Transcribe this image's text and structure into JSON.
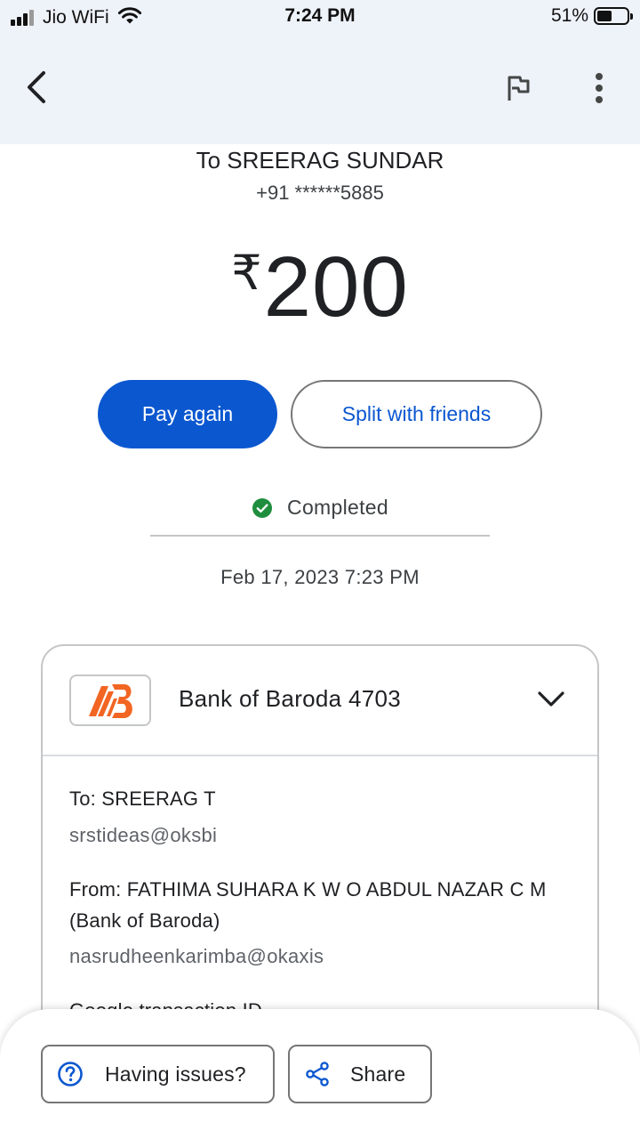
{
  "status_bar": {
    "carrier": "Jio WiFi",
    "time": "7:24 PM",
    "battery": "51%",
    "battery_level": 0.51,
    "signal_bars": 3
  },
  "app_bar": {
    "back_icon": "back-arrow-icon",
    "flag_icon": "flag-icon",
    "more_icon": "more-vert-icon"
  },
  "recipient": {
    "name": "To SREERAG SUNDAR",
    "phone": "+91 ******5885"
  },
  "amount": {
    "currency": "₹",
    "value": "200"
  },
  "actions": {
    "pay_again": "Pay again",
    "split": "Split with friends"
  },
  "status": {
    "text": "Completed",
    "date": "Feb 17, 2023 7:23 PM",
    "icon": "check-circle-icon",
    "color": "#1e8e3e"
  },
  "card": {
    "bank_name": "Bank of Baroda 4703",
    "bank_logo": "bank-of-baroda-logo",
    "to_label": "To: SREERAG  T",
    "to_upi": "srstideas@oksbi",
    "from_label": "From: FATHIMA SUHARA  K W O ABDUL NAZAR  C M (Bank of Baroda)",
    "from_upi": "nasrudheenkarimba@okaxis",
    "txn_id_label": "Google transaction ID"
  },
  "bottom": {
    "issues": "Having issues?",
    "share": "Share",
    "issues_icon": "help-circle-icon",
    "share_icon": "share-icon"
  },
  "colors": {
    "primary": "#0b57d0",
    "bank_brand": "#f26522",
    "app_bar_bg": "#eef2f9"
  }
}
